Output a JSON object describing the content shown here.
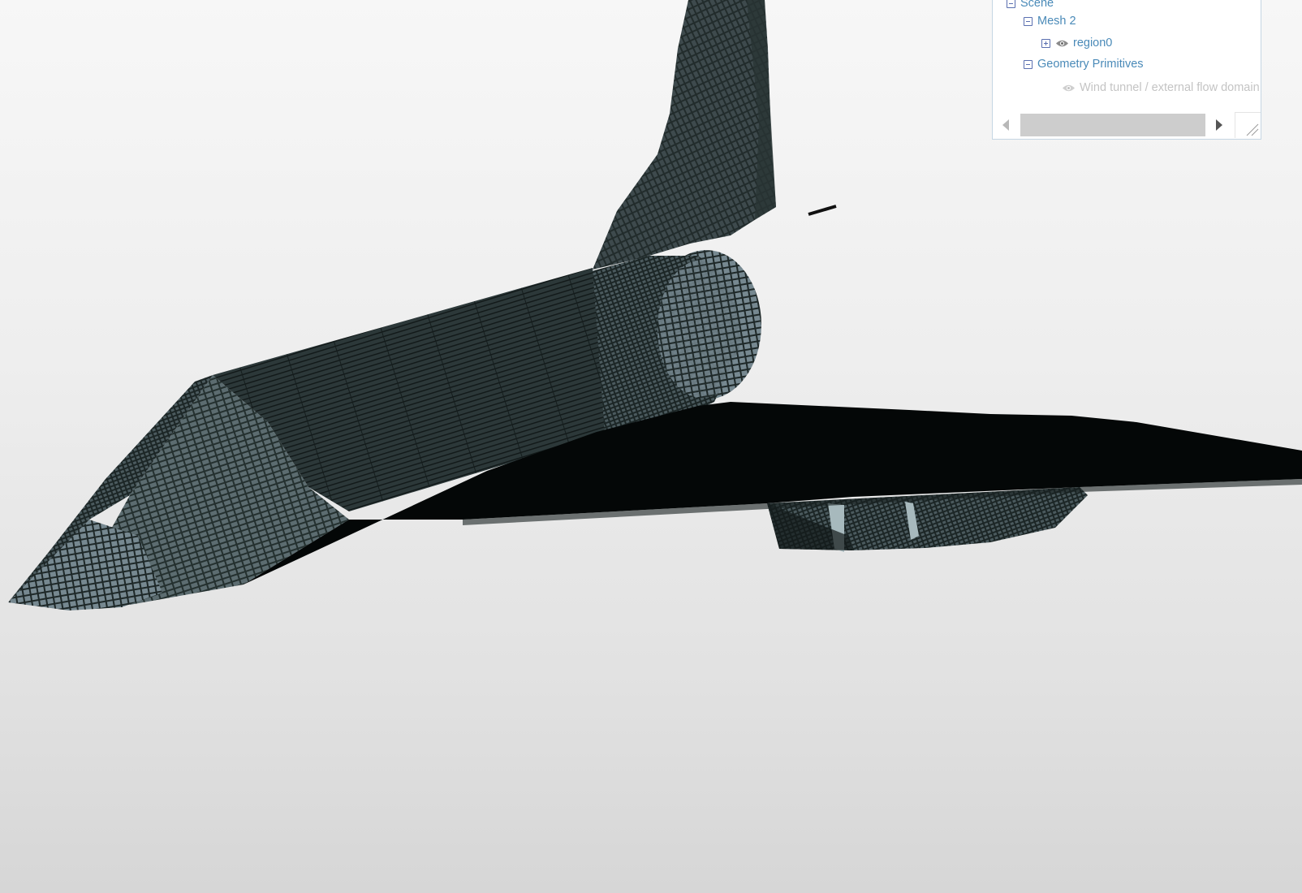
{
  "scene_tree": {
    "items": [
      {
        "label": "Scene",
        "toggle": "collapse",
        "visibility_icon": null,
        "enabled": true
      },
      {
        "label": "Mesh 2",
        "toggle": "collapse",
        "visibility_icon": null,
        "enabled": true
      },
      {
        "label": "region0",
        "toggle": "expand",
        "visibility_icon": "eye-icon",
        "enabled": true
      },
      {
        "label": "Geometry Primitives",
        "toggle": "collapse",
        "visibility_icon": null,
        "enabled": true
      },
      {
        "label": "Wind tunnel / external flow domain",
        "toggle": null,
        "visibility_icon": "eye-icon",
        "enabled": false
      }
    ]
  },
  "colors": {
    "tree_text": "#4a8ab8",
    "tree_text_disabled": "#c4c4c4",
    "toggle_border": "#5a6fb0",
    "mesh_dark": "#0d1414",
    "mesh_light": "#7b8c92",
    "background_top": "#f7f7f7",
    "background_bottom": "#d6d6d6"
  },
  "icons": {
    "collapse": "minus-box-icon",
    "expand": "plus-box-icon",
    "visibility": "eye-icon",
    "scroll_left": "arrow-left-icon",
    "scroll_right": "arrow-right-icon",
    "resize": "resize-grip-icon"
  }
}
